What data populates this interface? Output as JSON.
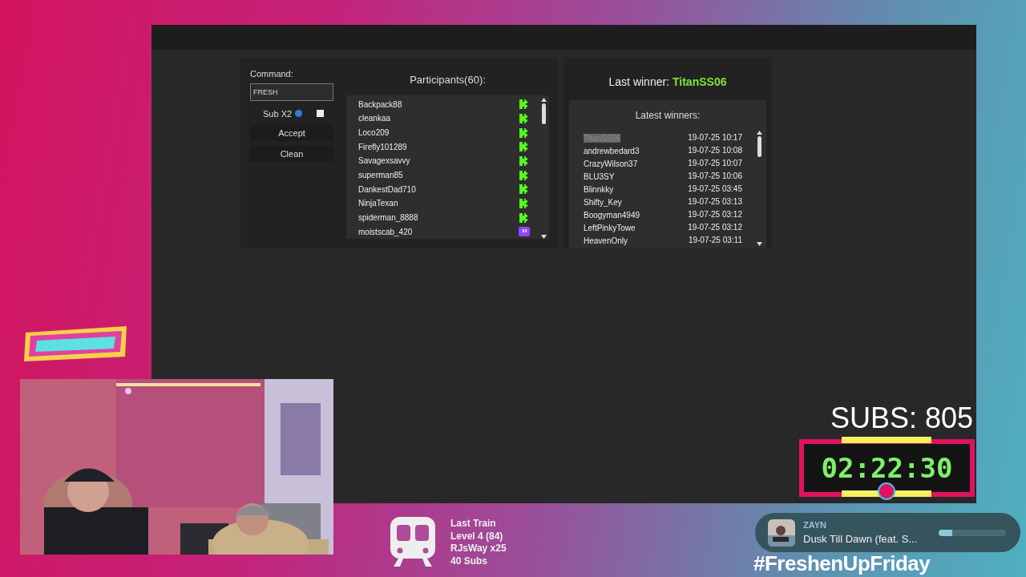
{
  "giveaway": {
    "command_label": "Command:",
    "command_value": "FRESH",
    "sub_x2": {
      "label": "Sub X2",
      "checked": false
    },
    "buttons": [
      "Accept",
      "Clean"
    ],
    "participants_title": "Participants(60):",
    "participants": [
      {
        "name": "Backpack88",
        "kind": "kick"
      },
      {
        "name": "cleankaa",
        "kind": "kick"
      },
      {
        "name": "Loco209",
        "kind": "kick"
      },
      {
        "name": "Firefly101289",
        "kind": "kick"
      },
      {
        "name": "Savagexsavvy",
        "kind": "kick"
      },
      {
        "name": "superman85",
        "kind": "kick"
      },
      {
        "name": "DankestDad710",
        "kind": "kick"
      },
      {
        "name": "NinjaTexan",
        "kind": "kick"
      },
      {
        "name": "spiderman_8888",
        "kind": "kick"
      },
      {
        "name": "moistscab_420",
        "kind": "twitch"
      }
    ],
    "last_winner_label": "Last winner:",
    "last_winner": "TitanSS06",
    "latest_title": "Latest winners:",
    "winners": [
      {
        "name": "TitanSS06",
        "time": "19-07-25 10:17",
        "selected": true
      },
      {
        "name": "andrewbedard3",
        "time": "19-07-25 10:08",
        "selected": false
      },
      {
        "name": "CrazyWilson37",
        "time": "19-07-25 10:07",
        "selected": false
      },
      {
        "name": "BLU3SY",
        "time": "19-07-25 10:06",
        "selected": false
      },
      {
        "name": "Blinnkky",
        "time": "19-07-25 03:45",
        "selected": false
      },
      {
        "name": "Shifty_Key",
        "time": "19-07-25 03:13",
        "selected": false
      },
      {
        "name": "Boogyman4949",
        "time": "19-07-25 03:12",
        "selected": false
      },
      {
        "name": "LeftPinkyTowe",
        "time": "19-07-25 03:12",
        "selected": false
      },
      {
        "name": "HeavenOnly",
        "time": "19-07-25 03:11",
        "selected": false
      }
    ]
  },
  "overlay": {
    "subs": "SUBS: 805",
    "timer": "02:22:30",
    "train": [
      "Last Train",
      "Level 4  (84)",
      "RJsWay x25",
      "40 Subs"
    ],
    "music": {
      "artist": "ZAYN",
      "title": "Dusk Till Dawn (feat. S...",
      "level": 0.2
    },
    "hashtag": "#FreshenUpFriday"
  }
}
